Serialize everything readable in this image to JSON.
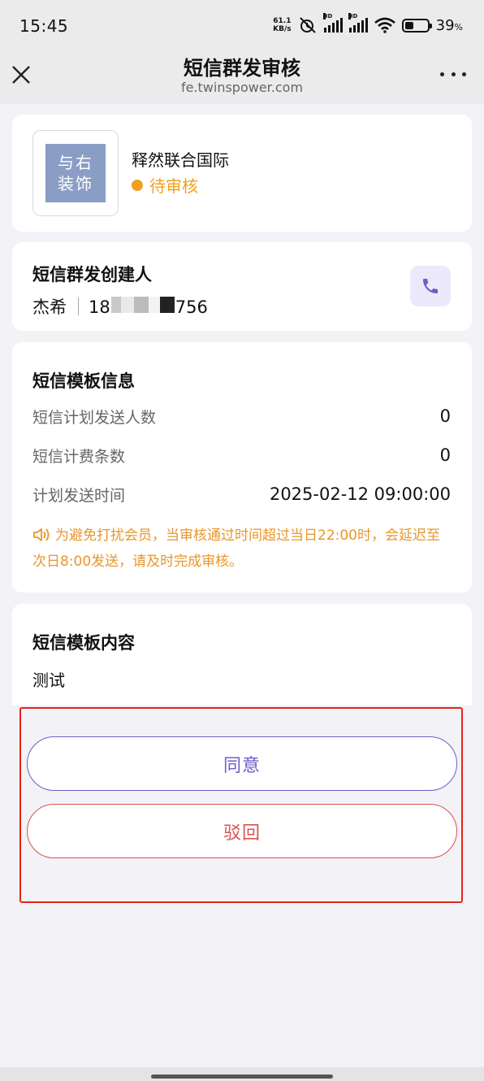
{
  "status_bar": {
    "time": "15:45",
    "net_speed_value": "61.1",
    "net_speed_unit": "KB/s",
    "signal_labels": [
      "HD",
      "HD"
    ],
    "battery_percent": "39",
    "battery_unit": "%",
    "battery_level": 0.39
  },
  "title_bar": {
    "title": "短信群发审核",
    "url": "fe.twinspower.com"
  },
  "shop": {
    "logo_text_line1": "与右",
    "logo_text_line2": "装饰",
    "name": "释然联合国际",
    "status": "待审核",
    "status_color": "#f0a020"
  },
  "creator": {
    "section_title": "短信群发创建人",
    "name": "杰希",
    "phone_visible_prefix": "18",
    "phone_visible_suffix": "756"
  },
  "template_info": {
    "section_title": "短信模板信息",
    "rows": [
      {
        "label": "短信计划发送人数",
        "value": "0"
      },
      {
        "label": "短信计费条数",
        "value": "0"
      },
      {
        "label": "计划发送时间",
        "value": "2025-02-12 09:00:00"
      }
    ],
    "notice": "为避免打扰会员，当审核通过时间超过当日22:00时，会延迟至次日8:00发送，请及时完成审核。",
    "notice_color": "#e8962a"
  },
  "template_content": {
    "section_title": "短信模板内容",
    "text": "测试"
  },
  "actions": {
    "approve_label": "同意",
    "reject_label": "驳回",
    "approve_color": "#6b5fc7",
    "reject_color": "#d9534f",
    "highlight_color": "#e8231a"
  }
}
